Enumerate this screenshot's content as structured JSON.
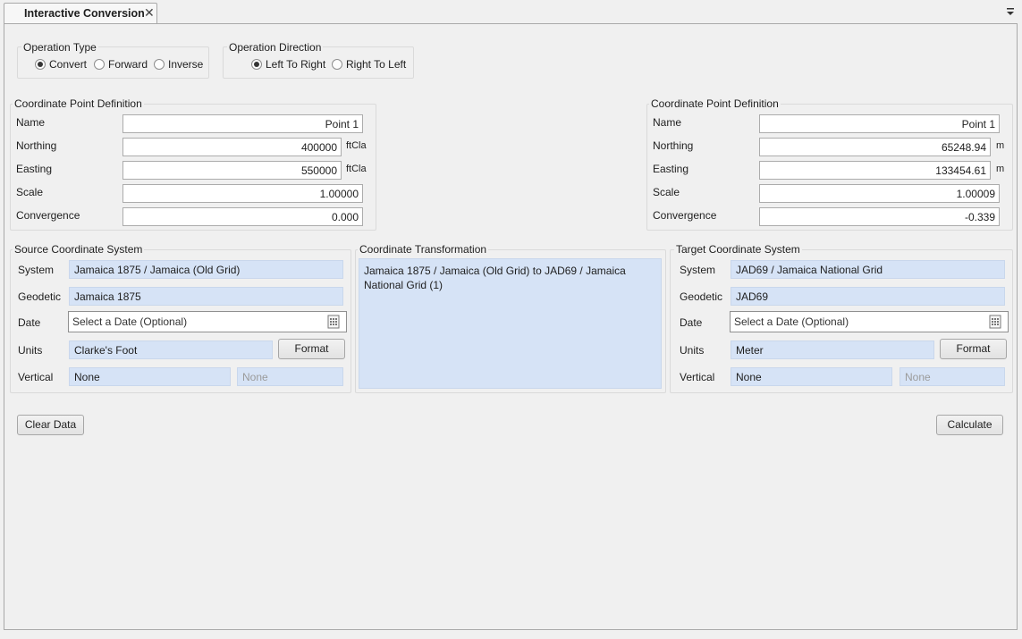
{
  "tab": {
    "title": "Interactive Conversion",
    "close_icon": "close-icon",
    "menu_icon": "chevron-down-icon"
  },
  "operation_type": {
    "label": "Operation Type",
    "options": [
      "Convert",
      "Forward",
      "Inverse"
    ],
    "selected": "Convert"
  },
  "operation_direction": {
    "label": "Operation Direction",
    "options": [
      "Left To Right",
      "Right To Left"
    ],
    "selected": "Left To Right"
  },
  "left_point": {
    "label": "Coordinate Point Definition",
    "name_label": "Name",
    "name_value": "Point 1",
    "northing_label": "Northing",
    "northing_value": "400000",
    "northing_unit": "ftCla",
    "easting_label": "Easting",
    "easting_value": "550000",
    "easting_unit": "ftCla",
    "scale_label": "Scale",
    "scale_value": "1.00000",
    "convergence_label": "Convergence",
    "convergence_value": "0.000"
  },
  "right_point": {
    "label": "Coordinate Point Definition",
    "name_label": "Name",
    "name_value": "Point 1",
    "northing_label": "Northing",
    "northing_value": "65248.94",
    "northing_unit": "m",
    "easting_label": "Easting",
    "easting_value": "133454.61",
    "easting_unit": "m",
    "scale_label": "Scale",
    "scale_value": "1.00009",
    "convergence_label": "Convergence",
    "convergence_value": "-0.339"
  },
  "source_cs": {
    "label": "Source Coordinate System",
    "system_label": "System",
    "system_value": "Jamaica 1875 / Jamaica (Old Grid)",
    "geodetic_label": "Geodetic",
    "geodetic_value": "Jamaica 1875",
    "date_label": "Date",
    "date_placeholder": "Select a Date (Optional)",
    "units_label": "Units",
    "units_value": "Clarke's Foot",
    "format_button": "Format",
    "vertical_label": "Vertical",
    "vertical_value": "None",
    "vertical_value2": "None"
  },
  "transformation": {
    "label": "Coordinate Transformation",
    "value": "Jamaica 1875 / Jamaica (Old Grid) to JAD69 / Jamaica National Grid (1)"
  },
  "target_cs": {
    "label": "Target Coordinate System",
    "system_label": "System",
    "system_value": "JAD69 / Jamaica National Grid",
    "geodetic_label": "Geodetic",
    "geodetic_value": "JAD69",
    "date_label": "Date",
    "date_placeholder": "Select a Date (Optional)",
    "units_label": "Units",
    "units_value": "Meter",
    "format_button": "Format",
    "vertical_label": "Vertical",
    "vertical_value": "None",
    "vertical_value2": "None"
  },
  "buttons": {
    "clear": "Clear Data",
    "calculate": "Calculate"
  }
}
